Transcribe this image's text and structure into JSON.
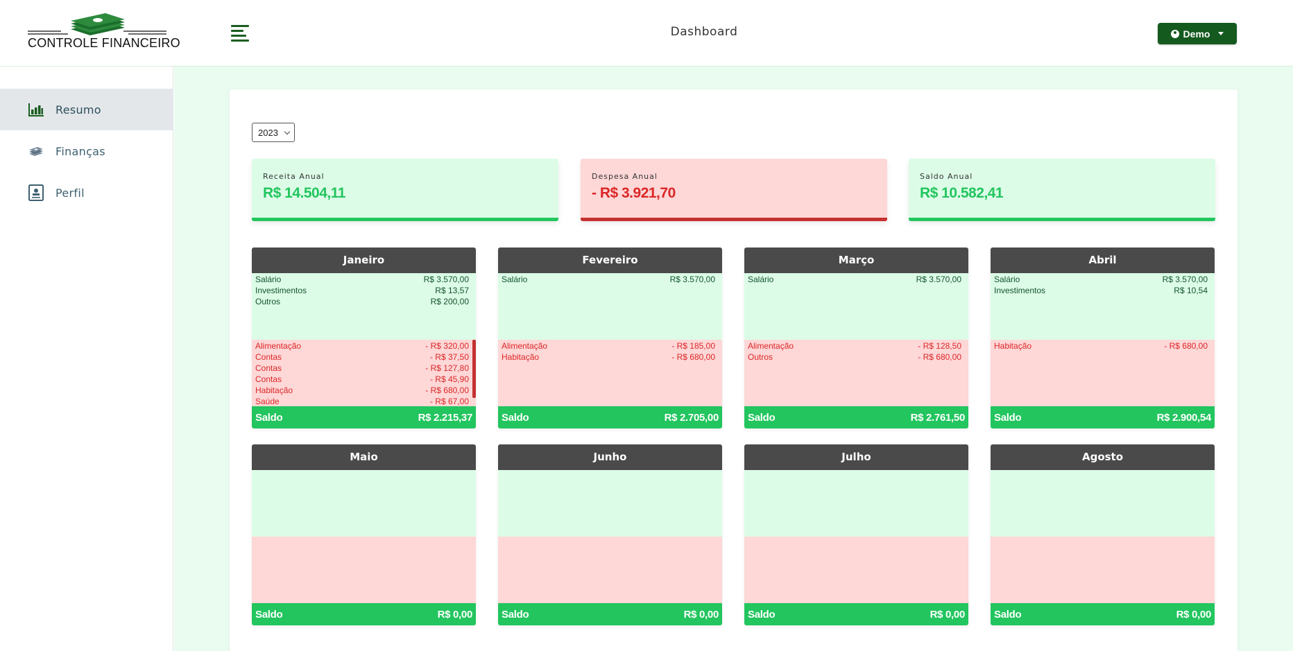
{
  "brand": {
    "name": "CONTROLE FINANCEIRO"
  },
  "header": {
    "title": "Dashboard",
    "user_label": "Demo"
  },
  "sidebar": {
    "items": [
      {
        "label": "Resumo",
        "icon": "bar-chart-icon",
        "active": true
      },
      {
        "label": "Finanças",
        "icon": "money-icon",
        "active": false
      },
      {
        "label": "Perfil",
        "icon": "profile-icon",
        "active": false
      }
    ]
  },
  "filters": {
    "year": "2023"
  },
  "summary": {
    "receita": {
      "label": "Receita Anual",
      "value": "R$ 14.504,11"
    },
    "despesa": {
      "label": "Despesa Anual",
      "value": "- R$ 3.921,70"
    },
    "saldo": {
      "label": "Saldo Anual",
      "value": "R$ 10.582,41"
    }
  },
  "colors": {
    "brand_green": "#145a1f",
    "income_bg": "#dcfce7",
    "expense_bg": "#fed7d7",
    "positive": "#22c55e",
    "negative": "#dc2626",
    "month_header": "#4a4a4a"
  },
  "balance_label": "Saldo",
  "months": [
    {
      "name": "Janeiro",
      "income": [
        {
          "label": "Salário",
          "value": "R$ 3.570,00"
        },
        {
          "label": "Investimentos",
          "value": "R$ 13,57"
        },
        {
          "label": "Outros",
          "value": "R$ 200,00"
        }
      ],
      "expenses": [
        {
          "label": "Alimentação",
          "value": "- R$ 320,00"
        },
        {
          "label": "Contas",
          "value": "- R$ 37,50"
        },
        {
          "label": "Contas",
          "value": "- R$ 127,80"
        },
        {
          "label": "Contas",
          "value": "- R$ 45,90"
        },
        {
          "label": "Habitação",
          "value": "- R$ 680,00"
        },
        {
          "label": "Saúde",
          "value": "- R$ 67,00"
        }
      ],
      "balance": "R$ 2.215,37"
    },
    {
      "name": "Fevereiro",
      "income": [
        {
          "label": "Salário",
          "value": "R$ 3.570,00"
        }
      ],
      "expenses": [
        {
          "label": "Alimentação",
          "value": "- R$ 185,00"
        },
        {
          "label": "Habitação",
          "value": "- R$ 680,00"
        }
      ],
      "balance": "R$ 2.705,00"
    },
    {
      "name": "Março",
      "income": [
        {
          "label": "Salário",
          "value": "R$ 3.570,00"
        }
      ],
      "expenses": [
        {
          "label": "Alimentação",
          "value": "- R$ 128,50"
        },
        {
          "label": "Outros",
          "value": "- R$ 680,00"
        }
      ],
      "balance": "R$ 2.761,50"
    },
    {
      "name": "Abril",
      "income": [
        {
          "label": "Salário",
          "value": "R$ 3.570,00"
        },
        {
          "label": "Investimentos",
          "value": "R$ 10,54"
        }
      ],
      "expenses": [
        {
          "label": "Habitação",
          "value": "- R$ 680,00"
        }
      ],
      "balance": "R$ 2.900,54"
    },
    {
      "name": "Maio",
      "income": [],
      "expenses": [],
      "balance": "R$ 0,00"
    },
    {
      "name": "Junho",
      "income": [],
      "expenses": [],
      "balance": "R$ 0,00"
    },
    {
      "name": "Julho",
      "income": [],
      "expenses": [],
      "balance": "R$ 0,00"
    },
    {
      "name": "Agosto",
      "income": [],
      "expenses": [],
      "balance": "R$ 0,00"
    }
  ]
}
